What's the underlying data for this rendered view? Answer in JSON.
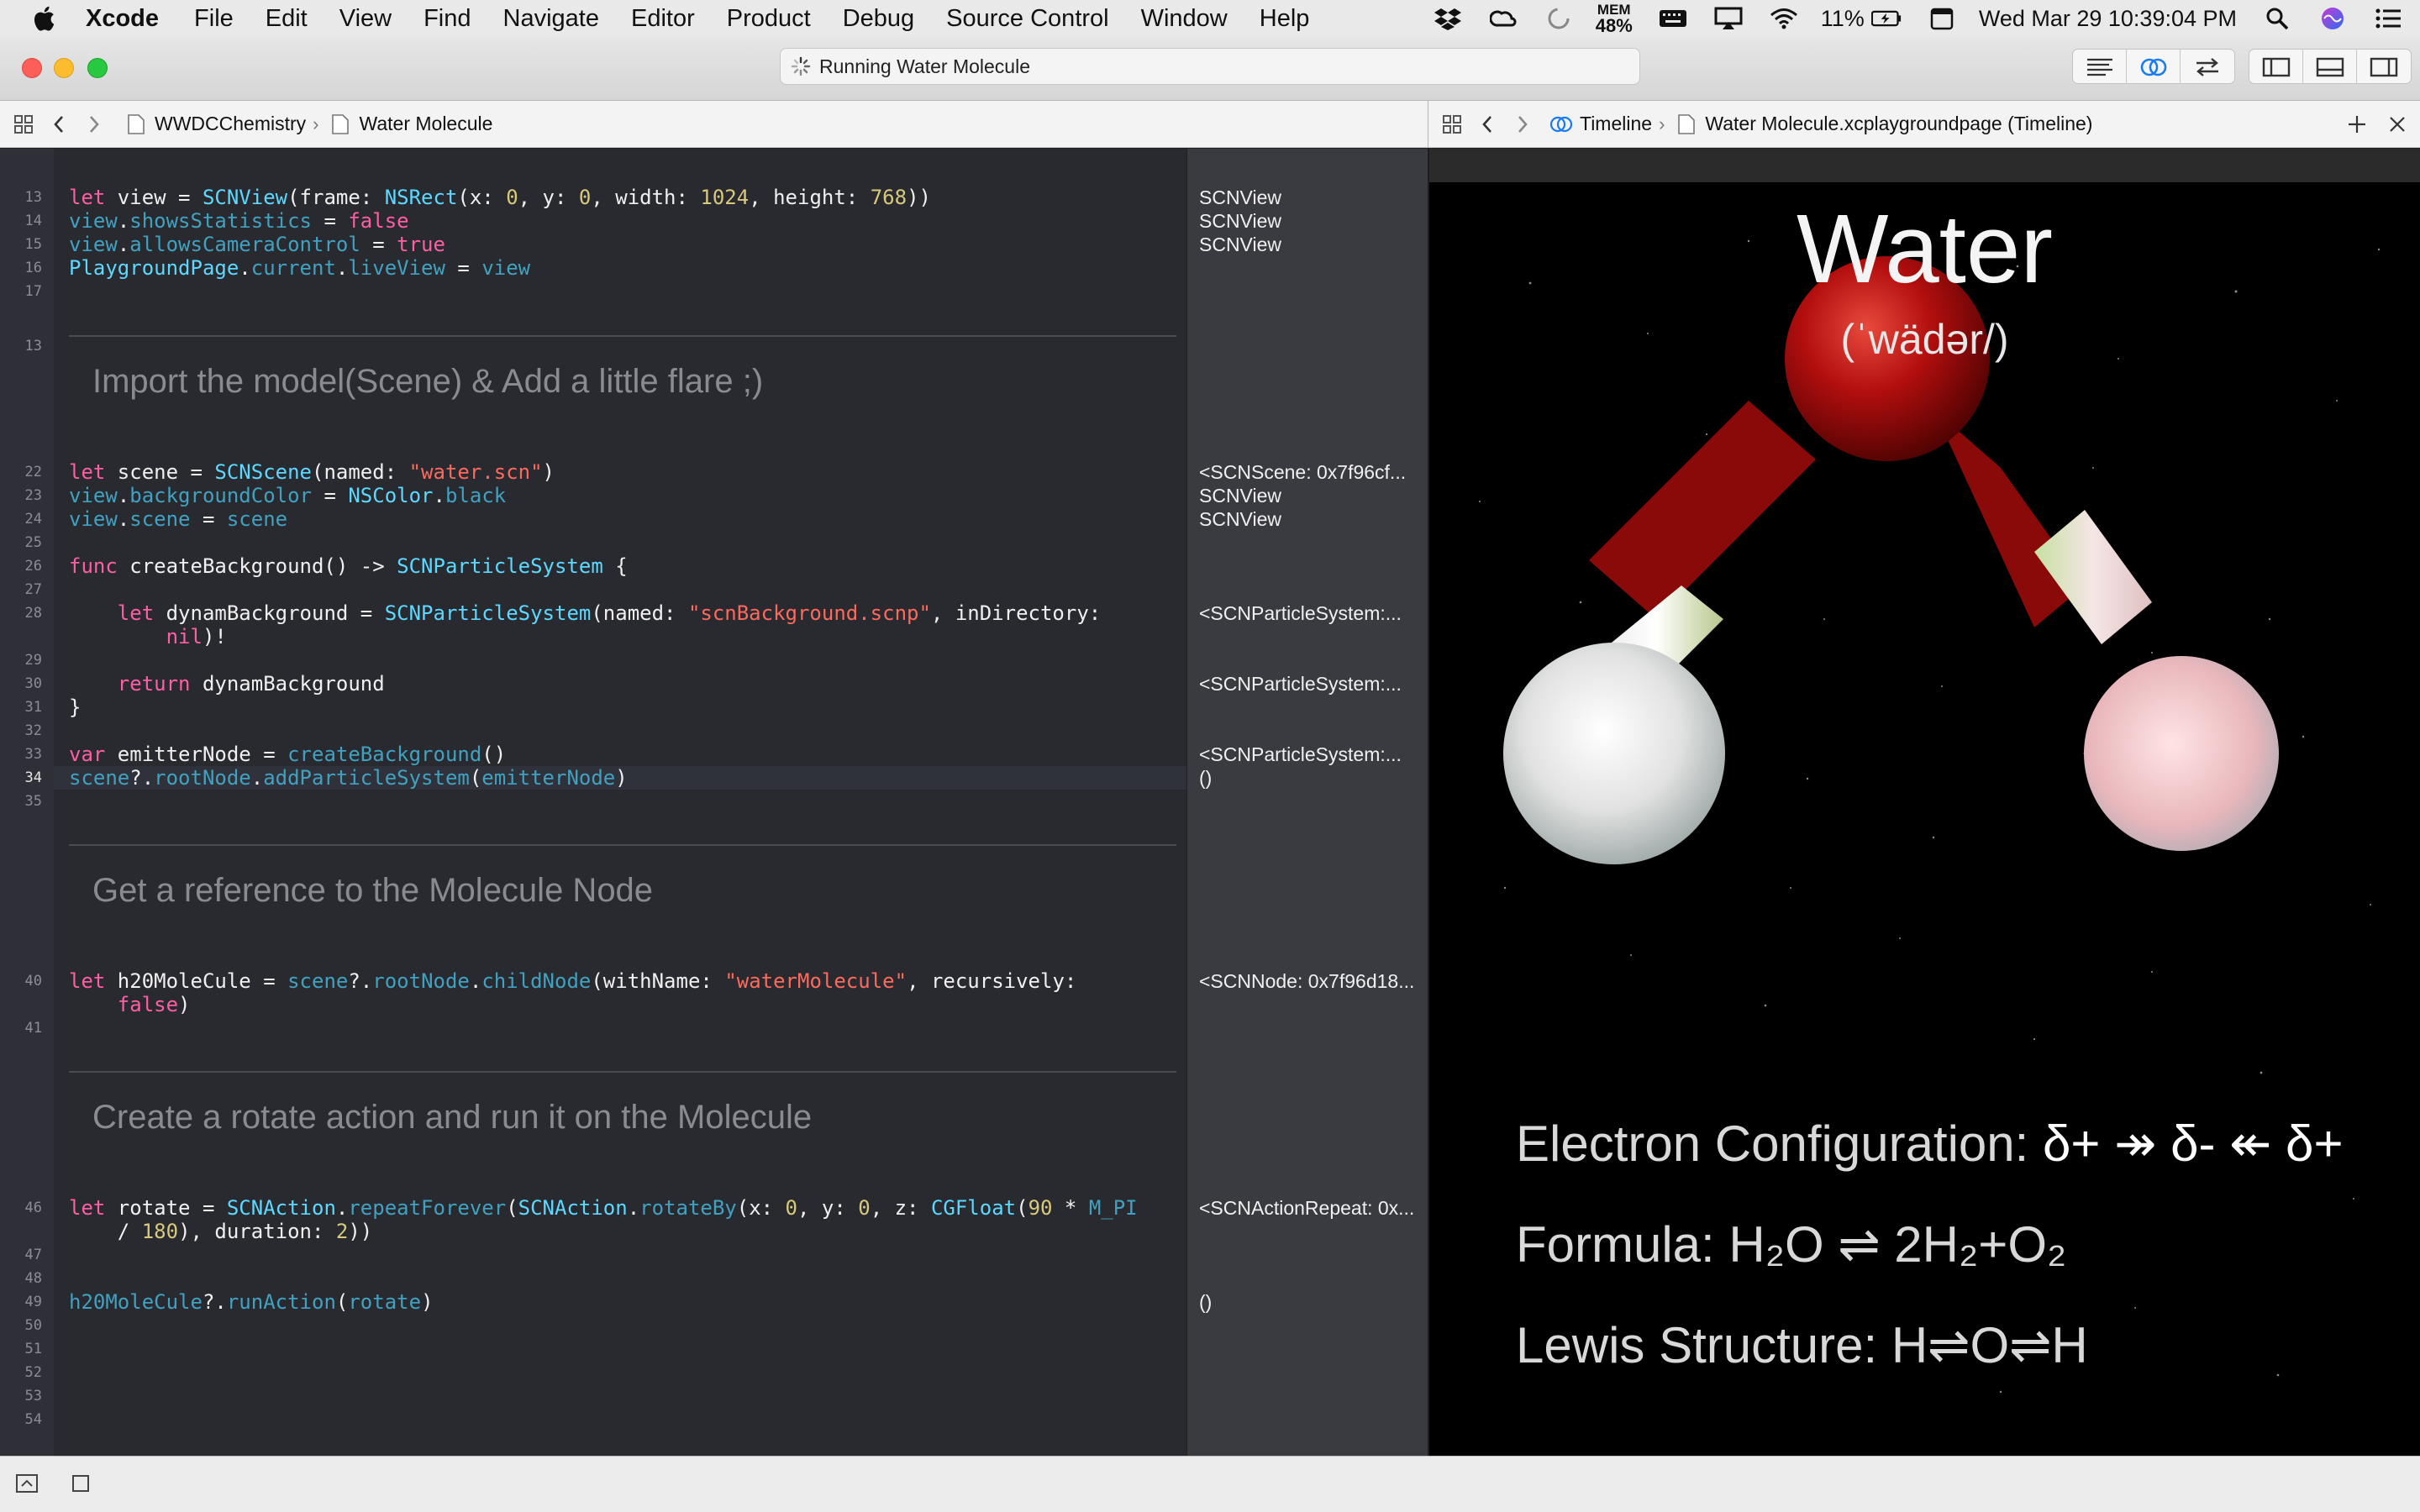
{
  "menubar": {
    "app_name": "Xcode",
    "items": [
      "File",
      "Edit",
      "View",
      "Find",
      "Navigate",
      "Editor",
      "Product",
      "Debug",
      "Source Control",
      "Window",
      "Help"
    ],
    "status": {
      "mem_label": "MEM",
      "mem_value": "48%",
      "battery": "11%",
      "clock": "Wed Mar 29  10:39:04 PM"
    },
    "icons": [
      "apple-logo",
      "dropbox-icon",
      "creative-cloud-icon",
      "sync-icon",
      "memory-icon",
      "keyboard-icon",
      "airplay-icon",
      "wifi-icon",
      "battery-icon",
      "calendar-icon",
      "spotlight-icon",
      "siri-icon",
      "notification-center-icon"
    ]
  },
  "toolbar": {
    "activity": "Running Water Molecule"
  },
  "jumpbar_left": {
    "project": "WWDCChemistry",
    "page": "Water Molecule"
  },
  "jumpbar_right": {
    "mode": "Timeline",
    "file": "Water Molecule.xcplaygroundpage (Timeline)"
  },
  "line_numbers": [
    {
      "n": "13",
      "row": 0
    },
    {
      "n": "14",
      "row": 1
    },
    {
      "n": "15",
      "row": 2
    },
    {
      "n": "16",
      "row": 3
    },
    {
      "n": "17",
      "row": 4
    },
    {
      "n": "22",
      "row": 0
    },
    {
      "n": "23",
      "row": 1
    },
    {
      "n": "24",
      "row": 2
    },
    {
      "n": "25",
      "row": 3
    },
    {
      "n": "26",
      "row": 4
    },
    {
      "n": "27",
      "row": 5
    },
    {
      "n": "28",
      "row": 6
    },
    {
      "n": "29",
      "row": 8
    },
    {
      "n": "30",
      "row": 9
    },
    {
      "n": "31",
      "row": 10
    },
    {
      "n": "32",
      "row": 11
    },
    {
      "n": "33",
      "row": 12
    },
    {
      "n": "34",
      "row": 13
    },
    {
      "n": "35",
      "row": 14
    },
    {
      "n": "40",
      "row": 0
    },
    {
      "n": "41",
      "row": 2
    },
    {
      "n": "46",
      "row": 0
    },
    {
      "n": "47",
      "row": 2
    },
    {
      "n": "48",
      "row": 3
    },
    {
      "n": "49",
      "row": 4
    },
    {
      "n": "50",
      "row": 5
    },
    {
      "n": "51",
      "row": 6
    },
    {
      "n": "52",
      "row": 7
    },
    {
      "n": "53",
      "row": 8
    },
    {
      "n": "54",
      "row": 9
    }
  ],
  "prose": {
    "p1": "Import the model(Scene) & Add a little flare ;)",
    "p2": "Get a reference to the Molecule Node",
    "p3": "Create a rotate action and run it on the Molecule"
  },
  "results": {
    "r13": "SCNView",
    "r14": "SCNView",
    "r15": "SCNView",
    "r22": "<SCNScene: 0x7f96cf...",
    "r23": "SCNView",
    "r24": "SCNView",
    "r28": "<SCNParticleSystem:...",
    "r30": "<SCNParticleSystem:...",
    "r33": "<SCNParticleSystem:...",
    "r34": "()",
    "r40": "<SCNNode: 0x7f96d18...",
    "r46": "<SCNActionRepeat: 0x...",
    "r49": "()"
  },
  "liveview": {
    "title": "Water",
    "pronunciation": "(ˈwädər/)",
    "electron_label": "Electron Configuration:",
    "electron_value": "δ+  ↠ δ- ↞ δ+",
    "formula_label": "Formula:",
    "formula_value": "H₂O ⇌ 2H₂+O₂",
    "lewis_label": "Lewis Structure:",
    "lewis_value": "H⇌O⇌H"
  },
  "colors": {
    "editor_bg": "#292a30",
    "keyword": "#fc5fa3",
    "type": "#5dd8ff",
    "property": "#41a1c0",
    "number": "#d9c97c",
    "string": "#fc6a5d",
    "oxygen": "#b50d0d",
    "hydrogen": "#e8e8e8"
  }
}
